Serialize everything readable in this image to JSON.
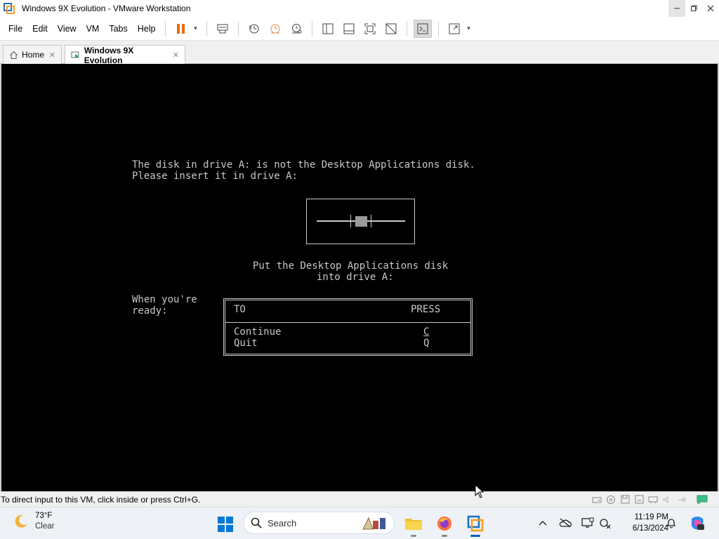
{
  "window": {
    "title": "Windows 9X Evolution - VMware Workstation"
  },
  "menu": {
    "items": [
      "File",
      "Edit",
      "View",
      "VM",
      "Tabs",
      "Help"
    ]
  },
  "tabs": [
    {
      "label": "Home",
      "icon": "home-icon",
      "active": false
    },
    {
      "label": "Windows 9X Evolution",
      "icon": "vm-icon",
      "active": true
    }
  ],
  "dos": {
    "line1": "The disk in drive A: is not the Desktop Applications disk.",
    "line2": "Please insert it in drive A:",
    "put1": "Put the Desktop Applications disk",
    "put2": "into drive A:",
    "when1": "When you're",
    "when2": "ready:",
    "col_to": "TO",
    "col_press": "PRESS",
    "opt1_label": "Continue",
    "opt1_key": "C",
    "opt2_label": "Quit",
    "opt2_key": "Q"
  },
  "status": {
    "text": "To direct input to this VM, click inside or press Ctrl+G."
  },
  "taskbar": {
    "temp": "73°F",
    "condition": "Clear",
    "search_placeholder": "Search",
    "time": "11:19 PM",
    "date": "6/13/2024"
  },
  "colors": {
    "pause_orange": "#e86a10",
    "vm_text": "#c8c8c8",
    "win_blue": "#0078d4"
  }
}
